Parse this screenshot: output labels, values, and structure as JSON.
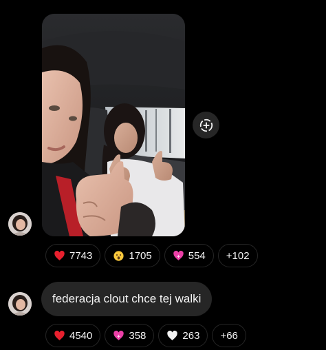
{
  "thread": {
    "media_message": {
      "save_icon": "circle-plus-dashed-icon",
      "reactions": [
        {
          "emoji": "red-heart",
          "count": "7743"
        },
        {
          "emoji": "surprised-face",
          "count": "1705"
        },
        {
          "emoji": "sparkling-heart",
          "count": "554"
        },
        {
          "emoji": "",
          "count": "+102"
        }
      ]
    },
    "text_message": {
      "text": "federacja clout chce tej walki",
      "reactions": [
        {
          "emoji": "red-heart",
          "count": "4540"
        },
        {
          "emoji": "sparkling-heart",
          "count": "358"
        },
        {
          "emoji": "white-heart",
          "count": "263"
        },
        {
          "emoji": "",
          "count": "+66"
        }
      ]
    }
  },
  "colors": {
    "background": "#000000",
    "bubble": "#262626",
    "pill_border": "#262626",
    "text": "#f5f5f5"
  }
}
